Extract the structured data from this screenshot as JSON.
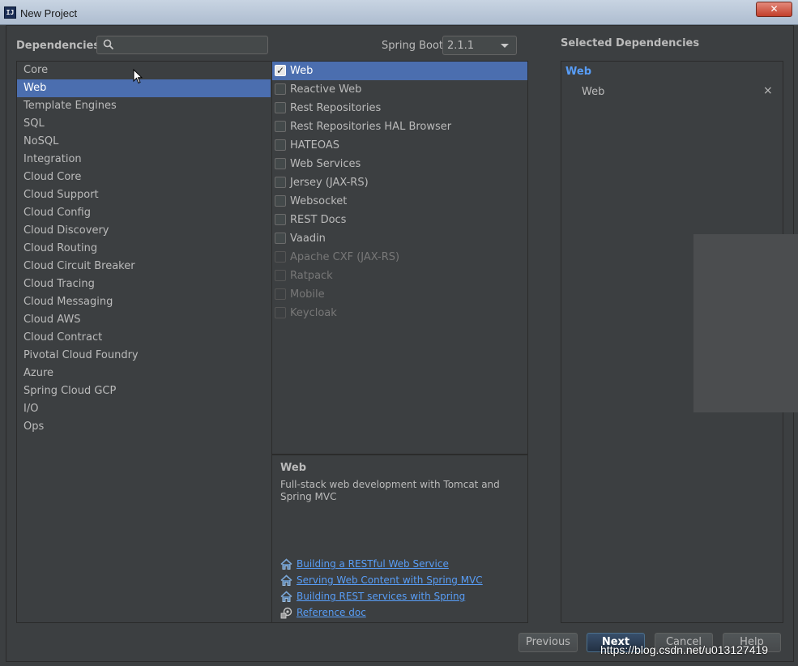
{
  "window": {
    "title": "New Project",
    "app_icon": "IJ",
    "close_icon": "✕"
  },
  "header": {
    "dependencies_label": "Dependencies",
    "search_placeholder": "",
    "spring_boot_label": "Spring Boot",
    "spring_boot_version": "2.1.1",
    "selected_dependencies_label": "Selected Dependencies"
  },
  "categories": [
    {
      "label": "Core",
      "selected": false
    },
    {
      "label": "Web",
      "selected": true
    },
    {
      "label": "Template Engines",
      "selected": false
    },
    {
      "label": "SQL",
      "selected": false
    },
    {
      "label": "NoSQL",
      "selected": false
    },
    {
      "label": "Integration",
      "selected": false
    },
    {
      "label": "Cloud Core",
      "selected": false
    },
    {
      "label": "Cloud Support",
      "selected": false
    },
    {
      "label": "Cloud Config",
      "selected": false
    },
    {
      "label": "Cloud Discovery",
      "selected": false
    },
    {
      "label": "Cloud Routing",
      "selected": false
    },
    {
      "label": "Cloud Circuit Breaker",
      "selected": false
    },
    {
      "label": "Cloud Tracing",
      "selected": false
    },
    {
      "label": "Cloud Messaging",
      "selected": false
    },
    {
      "label": "Cloud AWS",
      "selected": false
    },
    {
      "label": "Cloud Contract",
      "selected": false
    },
    {
      "label": "Pivotal Cloud Foundry",
      "selected": false
    },
    {
      "label": "Azure",
      "selected": false
    },
    {
      "label": "Spring Cloud GCP",
      "selected": false
    },
    {
      "label": "I/O",
      "selected": false
    },
    {
      "label": "Ops",
      "selected": false
    }
  ],
  "dependencies": [
    {
      "label": "Web",
      "checked": true,
      "enabled": true,
      "selected": true
    },
    {
      "label": "Reactive Web",
      "checked": false,
      "enabled": true,
      "selected": false
    },
    {
      "label": "Rest Repositories",
      "checked": false,
      "enabled": true,
      "selected": false
    },
    {
      "label": "Rest Repositories HAL Browser",
      "checked": false,
      "enabled": true,
      "selected": false
    },
    {
      "label": "HATEOAS",
      "checked": false,
      "enabled": true,
      "selected": false
    },
    {
      "label": "Web Services",
      "checked": false,
      "enabled": true,
      "selected": false
    },
    {
      "label": "Jersey (JAX-RS)",
      "checked": false,
      "enabled": true,
      "selected": false
    },
    {
      "label": "Websocket",
      "checked": false,
      "enabled": true,
      "selected": false
    },
    {
      "label": "REST Docs",
      "checked": false,
      "enabled": true,
      "selected": false
    },
    {
      "label": "Vaadin",
      "checked": false,
      "enabled": true,
      "selected": false
    },
    {
      "label": "Apache CXF (JAX-RS)",
      "checked": false,
      "enabled": false,
      "selected": false
    },
    {
      "label": "Ratpack",
      "checked": false,
      "enabled": false,
      "selected": false
    },
    {
      "label": "Mobile",
      "checked": false,
      "enabled": false,
      "selected": false
    },
    {
      "label": "Keycloak",
      "checked": false,
      "enabled": false,
      "selected": false
    }
  ],
  "description": {
    "title": "Web",
    "text": "Full-stack web development with Tomcat and Spring MVC",
    "links": [
      {
        "label": "Building a RESTful Web Service",
        "icon": "home-icon"
      },
      {
        "label": "Serving Web Content with Spring MVC",
        "icon": "home-icon"
      },
      {
        "label": "Building REST services with Spring",
        "icon": "home-icon"
      },
      {
        "label": "Reference doc",
        "icon": "reference-doc-icon"
      }
    ]
  },
  "selected": {
    "group": "Web",
    "items": [
      {
        "label": "Web",
        "remove_icon": "×"
      }
    ]
  },
  "buttons": {
    "previous": "Previous",
    "next": "Next",
    "cancel": "Cancel",
    "help": "Help"
  },
  "watermark": "https://blog.csdn.net/u013127419",
  "colors": {
    "background": "#3c3f41",
    "selection": "#4b6eaf",
    "link": "#589df6"
  }
}
